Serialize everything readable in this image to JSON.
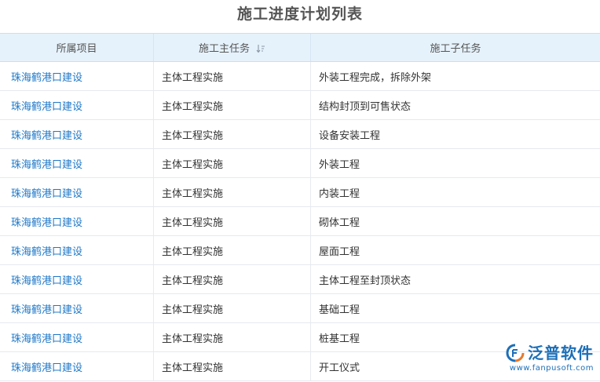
{
  "page": {
    "title": "施工进度计划列表"
  },
  "table": {
    "columns": [
      {
        "label": "所属项目"
      },
      {
        "label": "施工主任务"
      },
      {
        "label": "施工子任务"
      }
    ],
    "rows": [
      {
        "project": "珠海鹤港口建设",
        "main_task": "主体工程实施",
        "sub_task": "外装工程完成，拆除外架"
      },
      {
        "project": "珠海鹤港口建设",
        "main_task": "主体工程实施",
        "sub_task": "结构封顶到可售状态"
      },
      {
        "project": "珠海鹤港口建设",
        "main_task": "主体工程实施",
        "sub_task": "设备安装工程"
      },
      {
        "project": "珠海鹤港口建设",
        "main_task": "主体工程实施",
        "sub_task": "外装工程"
      },
      {
        "project": "珠海鹤港口建设",
        "main_task": "主体工程实施",
        "sub_task": "内装工程"
      },
      {
        "project": "珠海鹤港口建设",
        "main_task": "主体工程实施",
        "sub_task": "砌体工程"
      },
      {
        "project": "珠海鹤港口建设",
        "main_task": "主体工程实施",
        "sub_task": "屋面工程"
      },
      {
        "project": "珠海鹤港口建设",
        "main_task": "主体工程实施",
        "sub_task": "主体工程至封顶状态"
      },
      {
        "project": "珠海鹤港口建设",
        "main_task": "主体工程实施",
        "sub_task": "基础工程"
      },
      {
        "project": "珠海鹤港口建设",
        "main_task": "主体工程实施",
        "sub_task": "桩基工程"
      },
      {
        "project": "珠海鹤港口建设",
        "main_task": "主体工程实施",
        "sub_task": "开工仪式"
      }
    ]
  },
  "watermark": {
    "name": "泛普软件",
    "url": "www.fanpusoft.com",
    "icon": "fanpu-logo-icon"
  },
  "icons": {
    "sort": "sort-icon"
  },
  "colors": {
    "link": "#1f78c8",
    "header_bg": "#e6f2fb",
    "brand": "#1d6fb8",
    "logo_accent": "#e8792b"
  }
}
